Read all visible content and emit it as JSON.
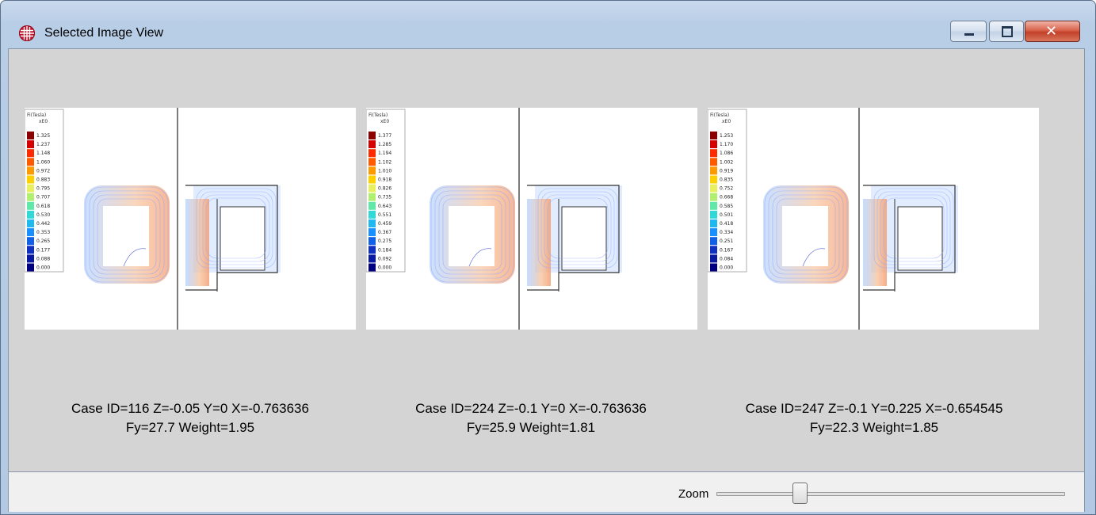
{
  "window": {
    "title": "Selected Image View",
    "icon": "grid-app-icon",
    "controls": {
      "minimize": "minimize-icon",
      "maximize": "maximize-icon",
      "close": "close-icon",
      "close_glyph": "✕"
    }
  },
  "panels": [
    {
      "legend_title": "Fi(Tesla)",
      "legend_scale": "xE0",
      "legend_values": [
        "1.325",
        "1.237",
        "1.148",
        "1.060",
        "0.972",
        "0.883",
        "0.795",
        "0.707",
        "0.618",
        "0.530",
        "0.442",
        "0.353",
        "0.265",
        "0.177",
        "0.088",
        "0.000"
      ],
      "caption_line1": "Case ID=116  Z=-0.05  Y=0  X=-0.763636",
      "caption_line2": "Fy=27.7  Weight=1.95"
    },
    {
      "legend_title": "Fi(Tesla)",
      "legend_scale": "xE0",
      "legend_values": [
        "1.377",
        "1.285",
        "1.194",
        "1.102",
        "1.010",
        "0.918",
        "0.826",
        "0.735",
        "0.643",
        "0.551",
        "0.459",
        "0.367",
        "0.275",
        "0.184",
        "0.092",
        "0.000"
      ],
      "caption_line1": "Case ID=224  Z=-0.1  Y=0  X=-0.763636",
      "caption_line2": "Fy=25.9  Weight=1.81"
    },
    {
      "legend_title": "Fi(Tesla)",
      "legend_scale": "xE0",
      "legend_values": [
        "1.253",
        "1.170",
        "1.086",
        "1.002",
        "0.919",
        "0.835",
        "0.752",
        "0.668",
        "0.585",
        "0.501",
        "0.418",
        "0.334",
        "0.251",
        "0.167",
        "0.084",
        "0.000"
      ],
      "caption_line1": "Case ID=247  Z=-0.1  Y=0.225  X=-0.654545",
      "caption_line2": "Fy=22.3  Weight=1.85"
    }
  ],
  "legend_colors": [
    "#8b0000",
    "#d40000",
    "#ff2a00",
    "#ff5a00",
    "#ff9a00",
    "#ffd000",
    "#e8f060",
    "#b0ef70",
    "#60e8a8",
    "#30d8d8",
    "#20b8f0",
    "#1890ff",
    "#1060e8",
    "#1030c0",
    "#0a1aa0",
    "#000080"
  ],
  "zoom": {
    "label": "Zoom",
    "value": 0.24
  }
}
